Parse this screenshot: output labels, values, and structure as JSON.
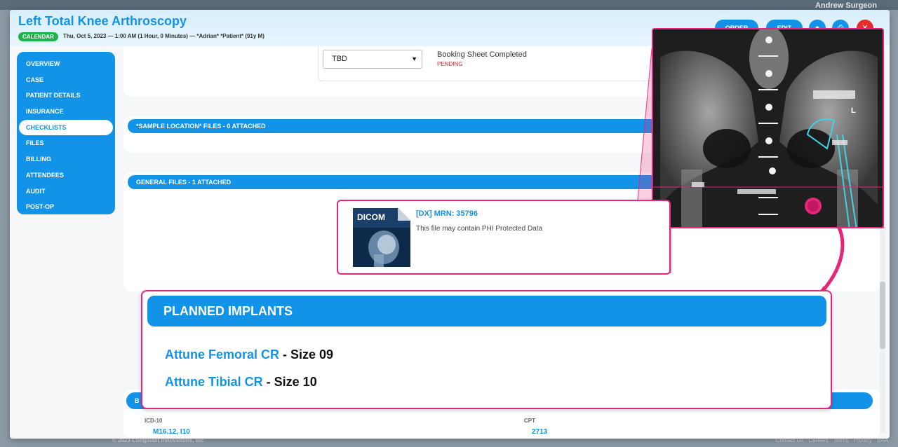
{
  "background": {
    "user_name": "Andrew Surgeon",
    "footer_copyright": "© 2023 Compliant Innovations, Inc",
    "footer_links": "Contact Us  ·  Careers  ·  Terms  ·  Privacy  ·  BAA"
  },
  "header": {
    "title": "Left Total Knee Arthroscopy",
    "calendar_badge": "CALENDAR",
    "subtitle": "Thu, Oct 5, 2023 — 1:00 AM (1 Hour, 0 Minutes) — *Adrian* *Patient* (91y M)",
    "order_label": "ORDER",
    "edit_label": "EDIT"
  },
  "sidebar": {
    "items": [
      {
        "label": "OVERVIEW"
      },
      {
        "label": "CASE"
      },
      {
        "label": "PATIENT DETAILS"
      },
      {
        "label": "INSURANCE"
      },
      {
        "label": "CHECKLISTS"
      },
      {
        "label": "FILES"
      },
      {
        "label": "BILLING"
      },
      {
        "label": "ATTENDEES"
      },
      {
        "label": "AUDIT"
      },
      {
        "label": "POST-OP"
      }
    ],
    "active": "CHECKLISTS"
  },
  "checklist": {
    "select_value": "TBD",
    "item_label": "Booking Sheet Completed",
    "item_status": "PENDING"
  },
  "sections": {
    "sample_files": "*SAMPLE LOCATION* FILES - 0 ATTACHED",
    "general_files": "GENERAL FILES - 1 ATTACHED",
    "billing_bar": "B"
  },
  "file": {
    "thumb_label": "DICOM",
    "link": "[DX] MRN: 35796",
    "note": "This file may contain PHI Protected Data"
  },
  "xray": {
    "side_marker": "L"
  },
  "implants": {
    "title": "PLANNED IMPLANTS",
    "items": [
      {
        "name": "Attune Femoral CR",
        "size": " - Size 09"
      },
      {
        "name": "Attune Tibial CR",
        "size": " - Size 10"
      }
    ]
  },
  "codes": {
    "icd_label": "ICD-10",
    "icd_value": "M16.12, I10",
    "cpt_label": "CPT",
    "cpt_value": "2713"
  },
  "colors": {
    "primary": "#1393e8",
    "highlight": "#e6267a",
    "success": "#22b24c",
    "danger": "#e82b2b"
  }
}
